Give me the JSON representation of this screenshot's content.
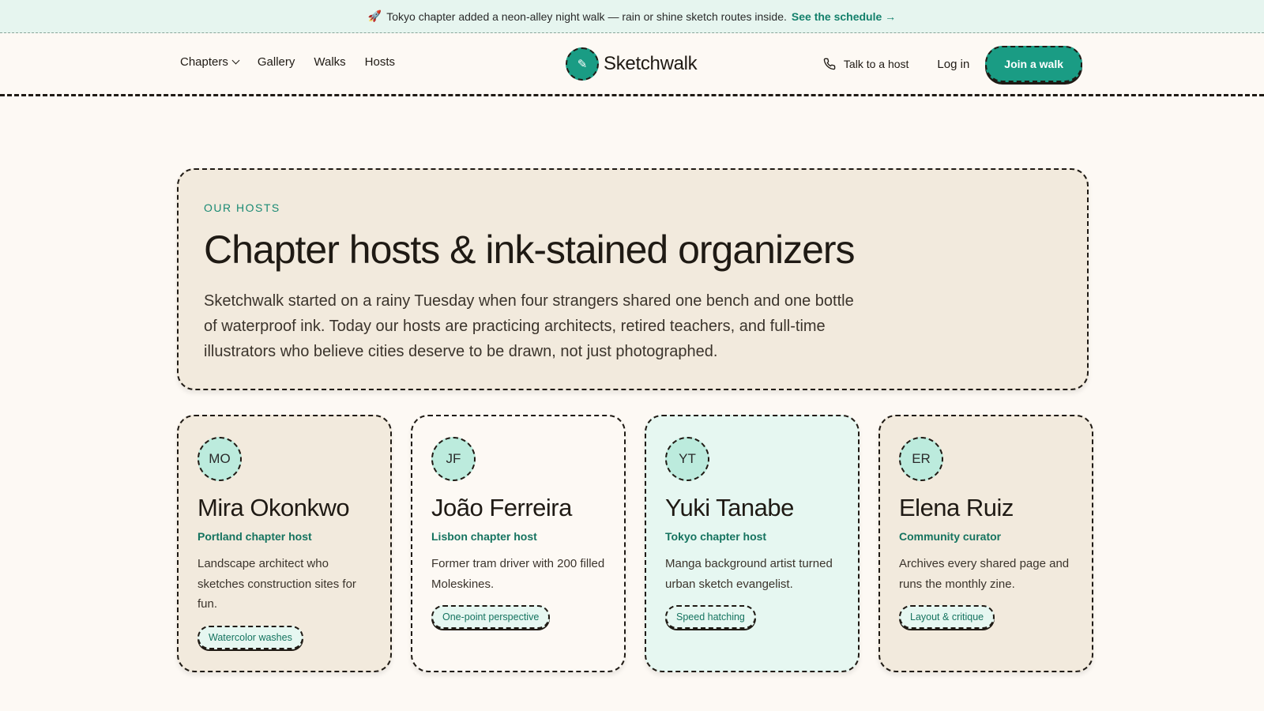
{
  "announcement": {
    "text": "Tokyo chapter added a neon-alley night walk — rain or shine sketch routes inside.",
    "link_label": "See the schedule →"
  },
  "nav": {
    "left": [
      {
        "label": "Chapters"
      },
      {
        "label": "Gallery"
      },
      {
        "label": "Walks"
      },
      {
        "label": "Hosts"
      }
    ],
    "brand": "Sketchwalk",
    "talk_label": "Talk to a host",
    "login_label": "Log in",
    "join_label": "Join a walk"
  },
  "hero": {
    "eyebrow": "OUR HOSTS",
    "title": "Chapter hosts & ink-stained organizers",
    "body": "Sketchwalk started on a rainy Tuesday when four strangers shared one bench and one bottle of waterproof ink. Today our hosts are practicing architects, retired teachers, and full-time illustrators who believe cities deserve to be drawn, not just photographed."
  },
  "hosts": [
    {
      "initials": "MO",
      "name": "Mira Okonkwo",
      "role": "Portland chapter host",
      "bio": "Landscape architect who sketches construction sites for fun.",
      "tag": "Watercolor washes"
    },
    {
      "initials": "JF",
      "name": "João Ferreira",
      "role": "Lisbon chapter host",
      "bio": "Former tram driver with 200 filled Moleskines.",
      "tag": "One-point perspective"
    },
    {
      "initials": "YT",
      "name": "Yuki Tanabe",
      "role": "Tokyo chapter host",
      "bio": "Manga background artist turned urban sketch evangelist.",
      "tag": "Speed hatching"
    },
    {
      "initials": "ER",
      "name": "Elena Ruiz",
      "role": "Community curator",
      "bio": "Archives every shared page and runs the monthly zine.",
      "tag": "Layout & critique"
    }
  ],
  "colors": {
    "accent": "#1a9c84",
    "background": "#fdf9f4",
    "card_beige": "#f2eadd",
    "card_mint": "#e6f7f1",
    "announcement_bg": "#e6f5ef"
  }
}
